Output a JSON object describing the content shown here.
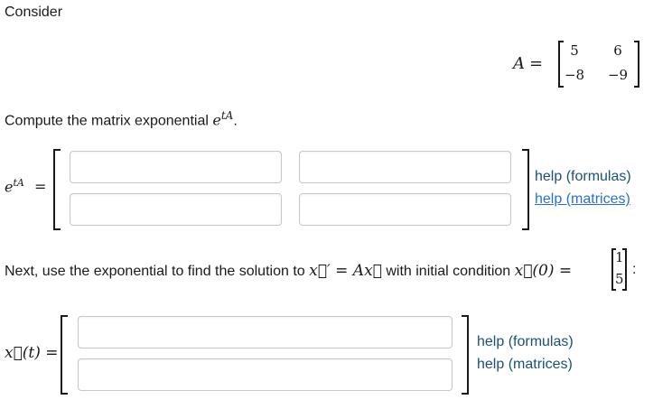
{
  "intro": "Consider",
  "matrix_A": {
    "name": "A",
    "equals": "=",
    "rows": [
      [
        "5",
        "6"
      ],
      [
        "−8",
        "−9"
      ]
    ]
  },
  "compute": {
    "text": "Compute the matrix exponential ",
    "expr_base": "e",
    "expr_sup": "tA",
    "period": "."
  },
  "expA": {
    "label_base": "e",
    "label_sup": "tA",
    "equals": "=",
    "inputs": [
      [
        "",
        ""
      ],
      [
        "",
        ""
      ]
    ],
    "help_formulas": "help (formulas)",
    "help_matrices": "help (matrices)"
  },
  "next": {
    "text1": "Next, use the exponential to find the solution to ",
    "eq": "x⃗′ = Ax⃗",
    "text2": " with initial condition ",
    "ic": "x⃗(0) =",
    "ic_vals": [
      "1",
      "5"
    ],
    "colon": ":"
  },
  "solution": {
    "label": "x⃗(t) =",
    "inputs": [
      "",
      ""
    ],
    "help_formulas": "help (formulas)",
    "help_matrices": "help (matrices)"
  }
}
